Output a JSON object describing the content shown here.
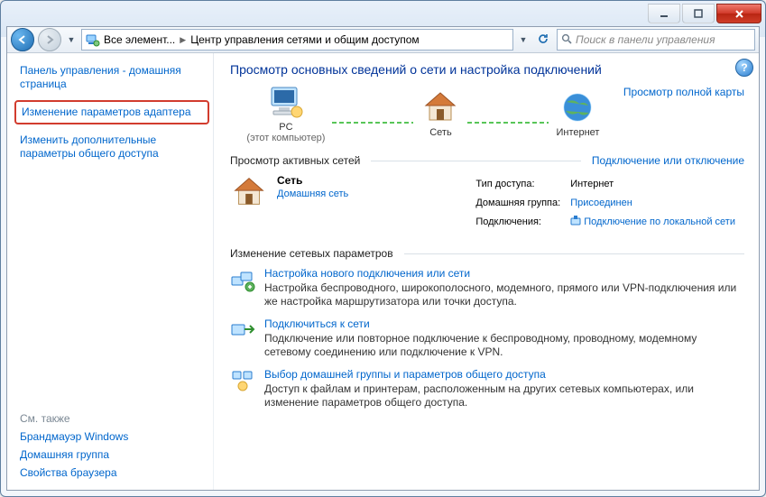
{
  "window": {
    "min_tip": "Minimize",
    "max_tip": "Maximize",
    "close_tip": "Close"
  },
  "address": {
    "crumb1": "Все элемент...",
    "crumb2": "Центр управления сетями и общим доступом",
    "search_placeholder": "Поиск в панели управления"
  },
  "side": {
    "home": "Панель управления - домашняя страница",
    "adapter": "Изменение параметров адаптера",
    "advshare": "Изменить дополнительные параметры общего доступа",
    "see_also": "См. также",
    "firewall": "Брандмауэр Windows",
    "homegroup": "Домашняя группа",
    "browser": "Свойства браузера"
  },
  "main": {
    "heading": "Просмотр основных сведений о сети и настройка подключений",
    "fullmap": "Просмотр полной карты",
    "map": {
      "pc": "PC",
      "pc_sub": "(этот компьютер)",
      "net": "Сеть",
      "inet": "Интернет"
    },
    "active_hdr": "Просмотр активных сетей",
    "active_link": "Подключение или отключение",
    "network": {
      "name": "Сеть",
      "type": "Домашняя сеть",
      "k1": "Тип доступа:",
      "v1": "Интернет",
      "k2": "Домашняя группа:",
      "v2": "Присоединен",
      "k3": "Подключения:",
      "v3": "Подключение по локальной сети"
    },
    "change_hdr": "Изменение сетевых параметров",
    "actions": {
      "a1_title": "Настройка нового подключения или сети",
      "a1_desc": "Настройка беспроводного, широкополосного, модемного, прямого или VPN-подключения или же настройка маршрутизатора или точки доступа.",
      "a2_title": "Подключиться к сети",
      "a2_desc": "Подключение или повторное подключение к беспроводному, проводному, модемному сетевому соединению или подключение к VPN.",
      "a3_title": "Выбор домашней группы и параметров общего доступа",
      "a3_desc": "Доступ к файлам и принтерам, расположенным на других сетевых компьютерах, или изменение параметров общего доступа."
    }
  }
}
